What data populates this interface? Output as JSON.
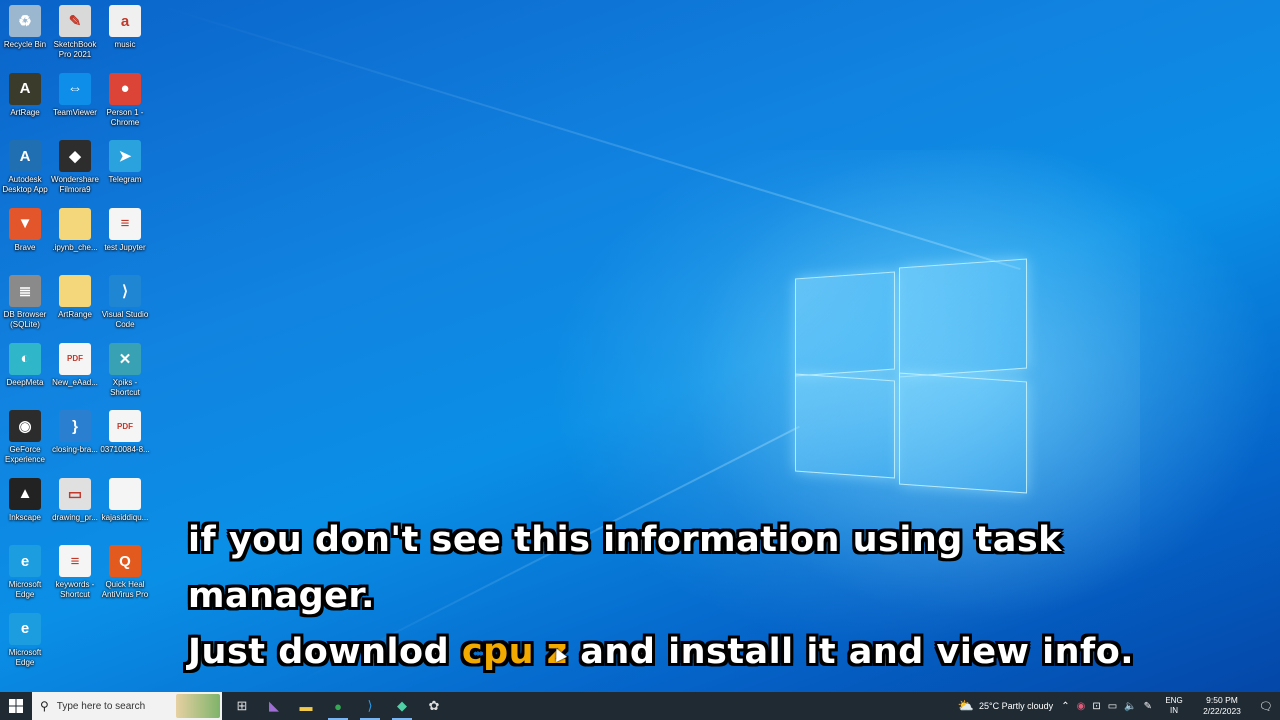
{
  "desktop_icons": [
    {
      "label": "Recycle Bin",
      "icon": "recycle-bin-icon",
      "color": "#9bb7cf",
      "glyph": "♻"
    },
    {
      "label": "SketchBook Pro 2021",
      "icon": "pencil-icon",
      "color": "#d9d9d9",
      "glyph": "✎"
    },
    {
      "label": "music",
      "icon": "document-icon",
      "color": "#f0f0f0",
      "glyph": "a"
    },
    {
      "label": "ArtRage",
      "icon": "artrage-icon",
      "color": "#3b3b2b",
      "glyph": "A"
    },
    {
      "label": "TeamViewer",
      "icon": "teamviewer-icon",
      "color": "#0e8ee9",
      "glyph": "⇔"
    },
    {
      "label": "Person 1 - Chrome",
      "icon": "chrome-icon",
      "color": "#db4437",
      "glyph": "●"
    },
    {
      "label": "Autodesk Desktop App",
      "icon": "autodesk-icon",
      "color": "#1f6fb2",
      "glyph": "A"
    },
    {
      "label": "Wondershare Filmora9",
      "icon": "filmora-icon",
      "color": "#2d2d2d",
      "glyph": "◆"
    },
    {
      "label": "Telegram",
      "icon": "telegram-icon",
      "color": "#2aa2dd",
      "glyph": "➤"
    },
    {
      "label": "Brave",
      "icon": "brave-icon",
      "color": "#e3552b",
      "glyph": "▼"
    },
    {
      "label": ".ipynb_che...",
      "icon": "folder-icon",
      "color": "#f4d77a",
      "glyph": ""
    },
    {
      "label": "test Jupyter",
      "icon": "document-icon",
      "color": "#f5f5f5",
      "glyph": "≡"
    },
    {
      "label": "DB Browser (SQLite)",
      "icon": "database-icon",
      "color": "#8a8a8a",
      "glyph": "≣"
    },
    {
      "label": "ArtRange",
      "icon": "folder-icon",
      "color": "#f4d77a",
      "glyph": ""
    },
    {
      "label": "Visual Studio Code",
      "icon": "vscode-icon",
      "color": "#1f86d4",
      "glyph": "⟩"
    },
    {
      "label": "DeepMeta",
      "icon": "deepmeta-icon",
      "color": "#2fb7c9",
      "glyph": "◐"
    },
    {
      "label": "New_eAad...",
      "icon": "pdf-icon",
      "color": "#f5f5f5",
      "glyph": "PDF"
    },
    {
      "label": "Xpiks - Shortcut",
      "icon": "xpiks-icon",
      "color": "#38a1b3",
      "glyph": "✕"
    },
    {
      "label": "GeForce Experience",
      "icon": "geforce-icon",
      "color": "#2c2c2c",
      "glyph": "◉"
    },
    {
      "label": "closing-bra...",
      "icon": "code-file-icon",
      "color": "#2a7fd0",
      "glyph": "}"
    },
    {
      "label": "03710084-8...",
      "icon": "pdf-icon",
      "color": "#f5f5f5",
      "glyph": "PDF"
    },
    {
      "label": "Inkscape",
      "icon": "inkscape-icon",
      "color": "#222222",
      "glyph": "▲"
    },
    {
      "label": "drawing_pr...",
      "icon": "image-file-icon",
      "color": "#e0e0e0",
      "glyph": "▭"
    },
    {
      "label": "kajasiddiqu...",
      "icon": "document-icon",
      "color": "#f5f5f5",
      "glyph": ""
    },
    {
      "label": "Microsoft Edge",
      "icon": "edge-icon",
      "color": "#1b9de0",
      "glyph": "e"
    },
    {
      "label": "keywords - Shortcut",
      "icon": "document-icon",
      "color": "#f5f5f5",
      "glyph": "≡"
    },
    {
      "label": "Quick Heal AntiVirus Pro",
      "icon": "quickheal-icon",
      "color": "#e35a1e",
      "glyph": "Q"
    },
    {
      "label": "Microsoft Edge",
      "icon": "edge-icon",
      "color": "#1b9de0",
      "glyph": "e"
    }
  ],
  "caption": {
    "line1": "if you don't see this information using task manager.",
    "line2_before": "Just downlod ",
    "line2_highlight": "cpu z",
    "line2_after": " and install it and view info.",
    "highlight_color": "#f2a900"
  },
  "taskbar": {
    "search_placeholder": "Type here to search",
    "apps": [
      {
        "name": "task-view",
        "glyph": "⊞",
        "active": false
      },
      {
        "name": "visual-studio",
        "glyph": "◣",
        "active": false
      },
      {
        "name": "file-explorer",
        "glyph": "▬",
        "active": false
      },
      {
        "name": "chrome",
        "glyph": "●",
        "active": true
      },
      {
        "name": "vscode",
        "glyph": "⟩",
        "active": true
      },
      {
        "name": "filmora",
        "glyph": "◆",
        "active": true
      },
      {
        "name": "paint",
        "glyph": "✿",
        "active": false
      }
    ],
    "weather": "25°C  Partly cloudy",
    "language_top": "ENG",
    "language_bottom": "IN",
    "time": "9:50 PM",
    "date": "2/22/2023"
  }
}
